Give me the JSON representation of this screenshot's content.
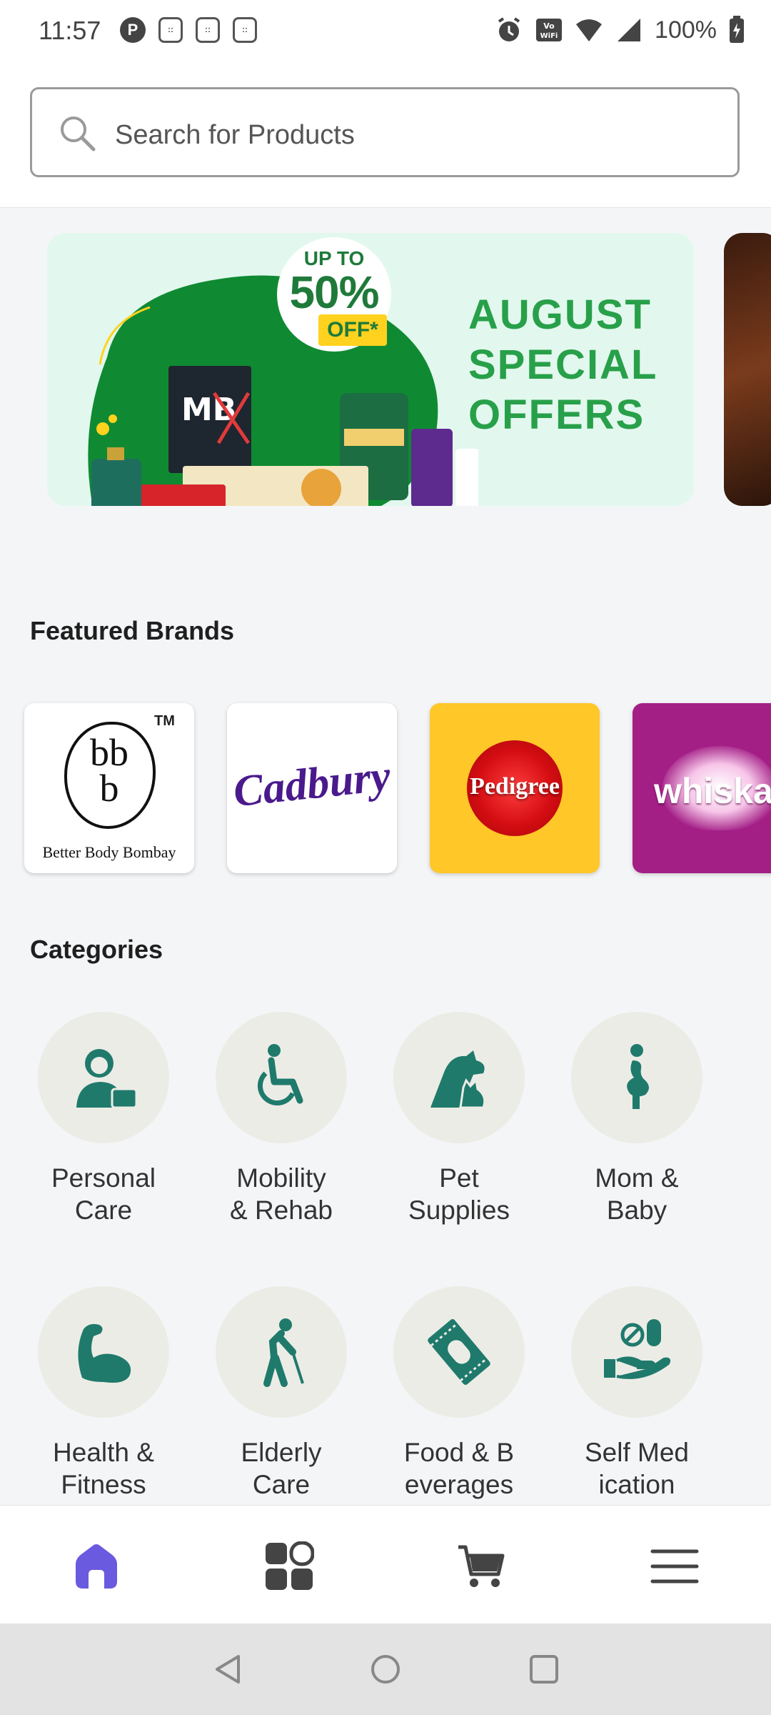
{
  "status_bar": {
    "time": "11:57",
    "battery": "100%",
    "icons": [
      "notification-icon",
      "sim-icon",
      "sim-icon",
      "sim-icon",
      "alarm-icon",
      "vowifi-icon",
      "wifi-icon",
      "signal-icon",
      "battery-icon"
    ]
  },
  "search": {
    "placeholder": "Search for Products"
  },
  "banner": {
    "badge_upto": "UP TO",
    "badge_percent": "50%",
    "badge_off": "OFF*",
    "title_lines": [
      "AUGUST",
      "SPECIAL",
      "OFFERS"
    ],
    "accent_color": "#28a04a"
  },
  "featured_brands": {
    "title": "Featured Brands",
    "brands": [
      {
        "name": "Better Body Bombay",
        "logo_text_1": "bb",
        "logo_text_2": "b",
        "tm": "TM"
      },
      {
        "name": "Cadbury"
      },
      {
        "name": "Pedigree"
      },
      {
        "name": "whiskas"
      }
    ]
  },
  "categories": {
    "title": "Categories",
    "items": [
      {
        "label": "Personal\nCare",
        "icon": "personal-care-icon"
      },
      {
        "label": "Mobility\n& Rehab",
        "icon": "wheelchair-icon"
      },
      {
        "label": "Pet\nSupplies",
        "icon": "pet-icon"
      },
      {
        "label": "Mom &\nBaby",
        "icon": "pregnancy-icon"
      },
      {
        "label": "Health &\nFitness",
        "icon": "muscle-icon"
      },
      {
        "label": "Elderly\nCare",
        "icon": "elderly-icon"
      },
      {
        "label": "Food & B\neverages",
        "icon": "food-packet-icon"
      },
      {
        "label": "Self Med\nication",
        "icon": "medicine-hand-icon"
      }
    ],
    "icon_color": "#1f7a6c"
  },
  "bottom_nav": {
    "items": [
      "home-icon",
      "categories-grid-icon",
      "cart-icon",
      "menu-icon"
    ],
    "active_color": "#6a5ae0"
  }
}
